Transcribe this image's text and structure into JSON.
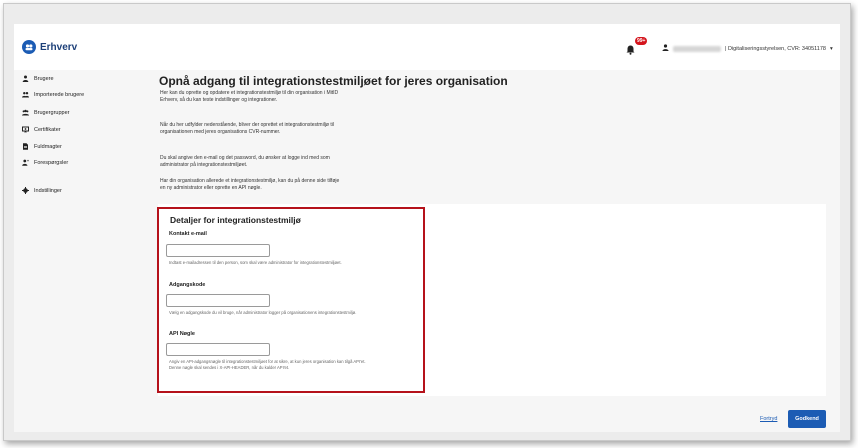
{
  "app": {
    "name": "Erhverv"
  },
  "header": {
    "notification_badge": "99+",
    "user_org": "| Digitaliseringsstyrelsen, CVR: 34051178",
    "dropdown_glyph": "▾"
  },
  "sidebar": {
    "items": [
      {
        "label": "Brugere",
        "icon": "person-icon"
      },
      {
        "label": "Importerede brugere",
        "icon": "people-import-icon"
      },
      {
        "label": "Brugergrupper",
        "icon": "group-icon"
      },
      {
        "label": "Certifikater",
        "icon": "certificate-icon"
      },
      {
        "label": "Fuldmagter",
        "icon": "document-icon"
      },
      {
        "label": "Forespørgsler",
        "icon": "person-add-icon"
      },
      {
        "label": "Indstillinger",
        "icon": "gear-icon"
      }
    ]
  },
  "main": {
    "title": "Opnå adgang til integrationstestmiljøet for jeres organisation",
    "paragraphs": [
      "Her kan du oprette og opdatere et integrationstestmiljø til din organisation i MitID Erhverv, så du kan teste indstillinger og integrationer.",
      "Når du her udfylder nedenstående, bliver der oprettet et integrationstestmiljø til organisationen med jeres organisations CVR-nummer.",
      "Du skal angive den e-mail og det password, du ønsker at logge ind med som administrator på integrationstestmiljøet.",
      "Har din organisation allerede et integrationstestmiljø, kan du på denne side tilføje en ny administrator eller oprette en API nøgle."
    ]
  },
  "form": {
    "title": "Detaljer for integrationstestmiljø",
    "email_label": "Kontakt e-mail",
    "email_value": "",
    "email_help": "Indtast e-mailadressen til den person, som skal være administrator for integrationstestmiljøet.",
    "password_label": "Adgangskode",
    "password_value": "",
    "password_help": "Vælg en adgangskode du vil bruge, når administrator logger på organisationens integrationstestmiljø.",
    "api_label": "API Nøgle",
    "api_value": "",
    "api_help_1": "Angiv en API-adgangsnøgle til integrationstestmiljøet for at sikre, at kun jeres organisation kan tilgå API'et.",
    "api_help_2": "Denne nøgle skal sendes i X-API-HEADER, når du kalder API'et."
  },
  "actions": {
    "cancel_label": "Fortryd",
    "submit_label": "Godkend"
  },
  "colors": {
    "accent": "#1c5cb4",
    "highlight_border": "#b5121b",
    "badge": "#d4141c"
  }
}
